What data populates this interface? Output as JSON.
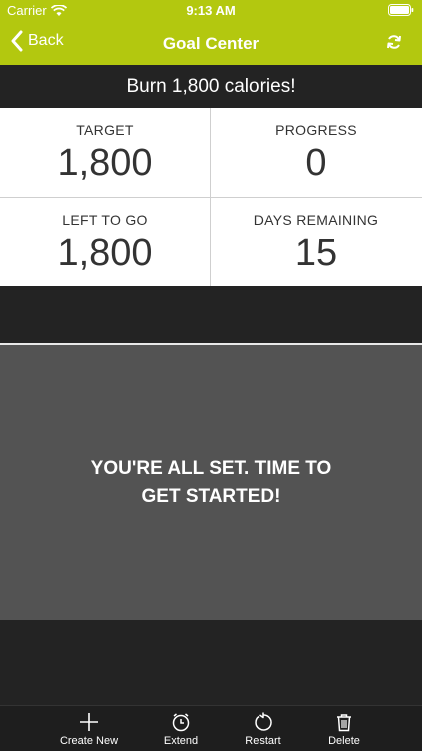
{
  "status_bar": {
    "carrier": "Carrier",
    "time": "9:13 AM"
  },
  "nav": {
    "back_label": "Back",
    "title": "Goal Center"
  },
  "goal": {
    "banner": "Burn 1,800 calories!"
  },
  "stats": [
    {
      "label": "TARGET",
      "value": "1,800"
    },
    {
      "label": "PROGRESS",
      "value": "0"
    },
    {
      "label": "LEFT TO GO",
      "value": "1,800"
    },
    {
      "label": "DAYS REMAINING",
      "value": "15"
    }
  ],
  "message": {
    "text": "YOU'RE ALL SET. TIME TO GET STARTED!"
  },
  "toolbar": {
    "create_new": "Create New",
    "extend": "Extend",
    "restart": "Restart",
    "delete": "Delete"
  },
  "colors": {
    "accent": "#b3c80f",
    "panel": "#535353",
    "background": "#232323"
  },
  "icons": {
    "back": "chevron-left-icon",
    "refresh": "refresh-icon",
    "create_new": "plus-icon",
    "extend": "alarm-clock-icon",
    "restart": "restart-icon",
    "delete": "trash-icon"
  }
}
